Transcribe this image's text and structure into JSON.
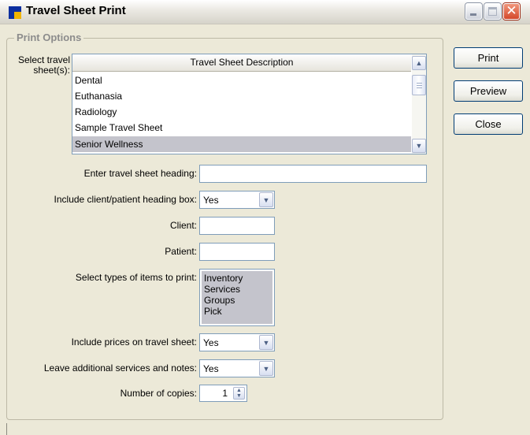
{
  "window": {
    "title": "Travel Sheet Print"
  },
  "group": {
    "title": "Print Options"
  },
  "sheets": {
    "label": "Select travel sheet(s):",
    "column_header": "Travel Sheet Description",
    "items": [
      {
        "label": "Dental",
        "selected": false
      },
      {
        "label": "Euthanasia",
        "selected": false
      },
      {
        "label": "Radiology",
        "selected": false
      },
      {
        "label": "Sample Travel Sheet",
        "selected": false
      },
      {
        "label": "Senior Wellness",
        "selected": true
      }
    ]
  },
  "heading": {
    "label": "Enter travel sheet heading:",
    "value": ""
  },
  "client_heading_box": {
    "label": "Include client/patient heading box:",
    "value": "Yes"
  },
  "client": {
    "label": "Client:",
    "value": ""
  },
  "patient": {
    "label": "Patient:",
    "value": ""
  },
  "item_types": {
    "label": "Select types of items to print:",
    "items": [
      "Inventory",
      "Services",
      "Groups",
      "Pick"
    ]
  },
  "include_prices": {
    "label": "Include prices on travel sheet:",
    "value": "Yes"
  },
  "additional_notes": {
    "label": "Leave additional services and notes:",
    "value": "Yes"
  },
  "copies": {
    "label": "Number of copies:",
    "value": "1"
  },
  "buttons": {
    "print": "Print",
    "preview": "Preview",
    "close": "Close"
  },
  "colors": {
    "selection": "#c4c4cc",
    "face": "#ece9d8",
    "border": "#7f9db9"
  }
}
